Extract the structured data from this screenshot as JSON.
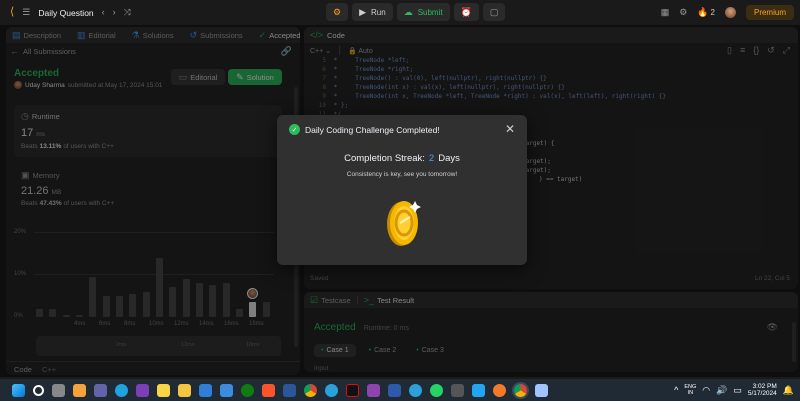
{
  "topbar": {
    "title": "Daily Question",
    "run_label": "Run",
    "submit_label": "Submit",
    "streak_count": "2",
    "premium_label": "Premium"
  },
  "left_tabs": [
    {
      "label": "Description"
    },
    {
      "label": "Editorial"
    },
    {
      "label": "Solutions"
    },
    {
      "label": "Submissions"
    },
    {
      "label": "Accepted"
    }
  ],
  "submission": {
    "back_label": "All Submissions",
    "status": "Accepted",
    "user": "Uday Sharma",
    "submitted_text": "submitted at May 17, 2024 15:01",
    "editorial_button": "Editorial",
    "solution_button": "Solution",
    "runtime_label": "Runtime",
    "runtime_value": "17",
    "runtime_unit": "ms",
    "runtime_beats_prefix": "Beats",
    "runtime_beats_value": "13.11%",
    "runtime_beats_suffix": "of users with C++",
    "memory_label": "Memory",
    "memory_value": "21.26",
    "memory_unit": "MB",
    "memory_beats_prefix": "Beats",
    "memory_beats_value": "47.43%",
    "memory_beats_suffix": "of users with C++",
    "y_ticks": [
      "20%",
      "10%",
      "0%"
    ],
    "x_ticks": [
      "4ms",
      "6ms",
      "8ms",
      "10ms",
      "12ms",
      "14ms",
      "16ms",
      "18ms"
    ],
    "mini_x_ticks": [
      "2ms",
      "13ms",
      "18ms"
    ],
    "bar_values": [
      2,
      2,
      0.5,
      0.5,
      9.5,
      5,
      5,
      5.5,
      6,
      14,
      7,
      9,
      8,
      7.5,
      8,
      2,
      3.5,
      3.5
    ],
    "highlight_index": 16,
    "footer_code": "Code",
    "footer_lang": "C++"
  },
  "code_panel": {
    "title": "Code",
    "language": "C++",
    "auto": "Auto",
    "lines": [
      {
        "n": "5",
        "text": " *     TreeNode *left;"
      },
      {
        "n": "6",
        "text": " *     TreeNode *right;"
      },
      {
        "n": "7",
        "text": " *     TreeNode() : val(0), left(nullptr), right(nullptr) {}"
      },
      {
        "n": "8",
        "text": " *     TreeNode(int x) : val(x), left(nullptr), right(nullptr) {}"
      },
      {
        "n": "9",
        "text": " *     TreeNode(int x, TreeNode *left, TreeNode *right) : val(x), left(left), right(right) {}"
      },
      {
        "n": "10",
        "text": " * };"
      },
      {
        "n": "11",
        "text": " */"
      }
    ],
    "partial_lines": [
      "target) {",
      "target);",
      "target);",
      ") == target)"
    ],
    "saved": "Saved",
    "cursor_pos": "Ln 22, Col 5"
  },
  "result_panel": {
    "testcase_tab": "Testcase",
    "result_tab": "Test Result",
    "status": "Accepted",
    "runtime": "Runtime: 0 ms",
    "cases": [
      "Case 1",
      "Case 2",
      "Case 3"
    ],
    "input_label": "Input"
  },
  "modal": {
    "title": "Daily Coding Challenge Completed!",
    "streak_prefix": "Completion Streak:",
    "streak_value": "2",
    "streak_suffix": "Days",
    "message": "Consistency is key, see you tomorrow!"
  },
  "taskbar": {
    "time": "3:02 PM",
    "date": "5/17/2024",
    "lang": "ENG\nIN"
  },
  "colors": {
    "accent_green": "#2cbb5d",
    "accent_orange": "#ffa116",
    "coin_gold": "#f5b800",
    "streak_blue": "#4a9eff"
  }
}
